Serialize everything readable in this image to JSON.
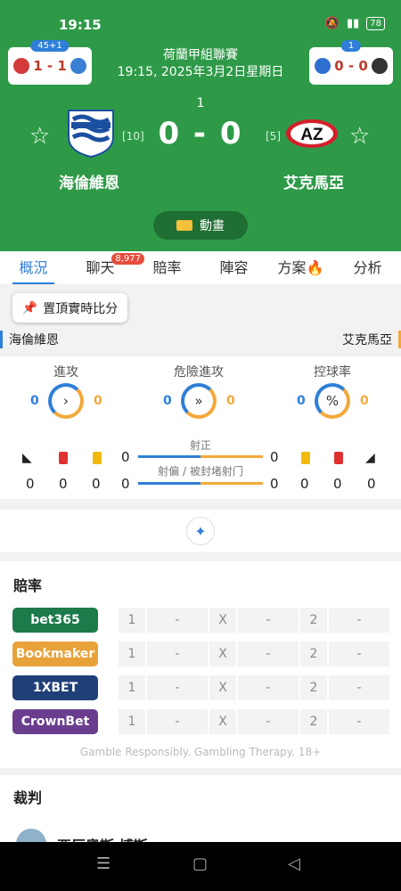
{
  "status": {
    "time": "19:15",
    "battery": "78"
  },
  "header": {
    "league": "荷蘭甲組聯賽",
    "datetime": "19:15, 2025年3月2日星期日",
    "minute": "1",
    "score": "0 - 0",
    "home": {
      "name": "海倫維恩",
      "rank": "[10]"
    },
    "away": {
      "name": "艾克馬亞",
      "rank": "[5]",
      "logo_text": "AZ"
    },
    "animation_label": "動畫",
    "mini_left": {
      "tag": "45+1",
      "score": "1 - 1"
    },
    "mini_right": {
      "tag": "1",
      "score": "0 - 0"
    }
  },
  "tabs": [
    {
      "label": "概況"
    },
    {
      "label": "聊天",
      "badge": "8,977"
    },
    {
      "label": "賠率"
    },
    {
      "label": "陣容"
    },
    {
      "label": "方案"
    },
    {
      "label": "分析"
    }
  ],
  "pin_label": "置頂實時比分",
  "stats": {
    "home_name": "海倫維恩",
    "away_name": "艾克馬亞",
    "attack": {
      "label": "進攻",
      "home": "0",
      "away": "0",
      "icon": "›"
    },
    "danger": {
      "label": "危險進攻",
      "home": "0",
      "away": "0",
      "icon": "»"
    },
    "possession": {
      "label": "控球率",
      "home": "0",
      "away": "0",
      "icon": "%"
    },
    "shots_on": {
      "label": "射正",
      "home": "0",
      "away": "0"
    },
    "shots_off": {
      "label": "射偏 / 被封堵射门",
      "home": "0",
      "away": "0"
    },
    "home_corners": "0",
    "home_red": "0",
    "home_yellow": "0",
    "away_yellow": "0",
    "away_red": "0",
    "away_corners": "0"
  },
  "odds": {
    "title": "賠率",
    "books": [
      {
        "name": "bet365",
        "color": "#1d7a4b"
      },
      {
        "name": "Bookmaker",
        "color": "#e8a23a"
      },
      {
        "name": "1XBET",
        "color": "#1f3f78"
      },
      {
        "name": "CrownBet",
        "color": "#6a3d8f"
      }
    ],
    "cols": [
      "1",
      "-",
      "X",
      "-",
      "2",
      "-"
    ],
    "disclaimer": "Gamble Responsibly. Gambling Therapy. 18+"
  },
  "referee": {
    "title": "裁判",
    "name": "亜厄奧斯 博斯"
  }
}
